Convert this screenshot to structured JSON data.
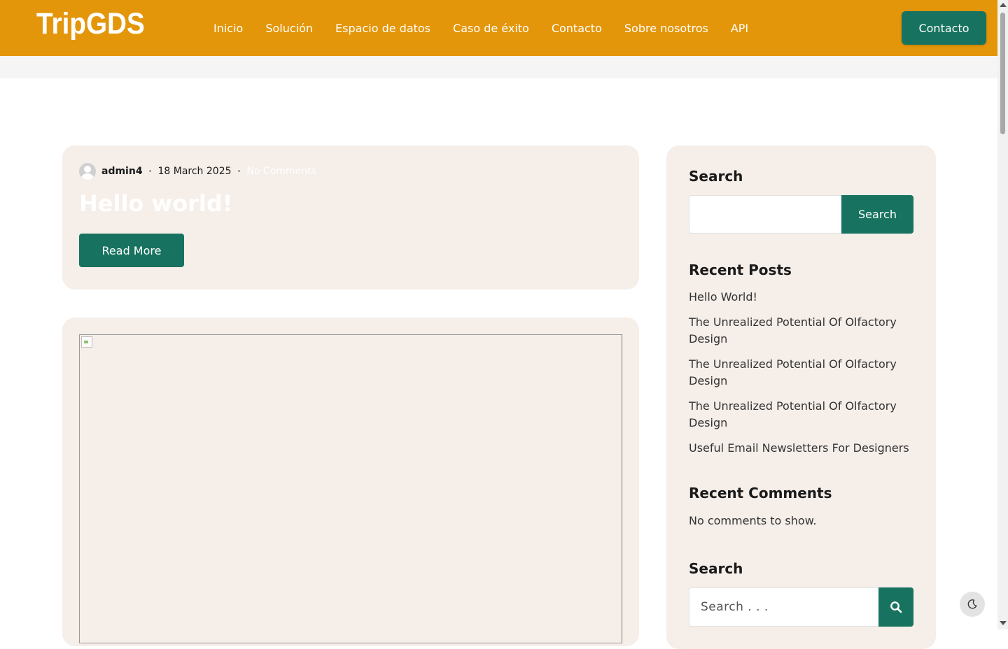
{
  "brand": {
    "logo": "TripGDS"
  },
  "nav": {
    "items": [
      "Inicio",
      "Solución",
      "Espacio de datos",
      "Caso de éxito",
      "Contacto",
      "Sobre nosotros",
      "API"
    ],
    "cta": "Contacto"
  },
  "post": {
    "author": "admin4",
    "date": "18 March 2025",
    "comments": "No Comments",
    "title": "Hello world!",
    "read_more": "Read More"
  },
  "sidebar": {
    "search_title": "Search",
    "search_button": "Search",
    "recent_posts_title": "Recent Posts",
    "recent_posts": [
      "Hello World!",
      "The Unrealized Potential Of Olfactory Design",
      "The Unrealized Potential Of Olfactory Design",
      "The Unrealized Potential Of Olfactory Design",
      "Useful Email Newsletters For Designers"
    ],
    "recent_comments_title": "Recent Comments",
    "no_comments": "No comments to show.",
    "search2_title": "Search",
    "search2_placeholder": "Search . . ."
  },
  "colors": {
    "header": "#e4960a",
    "accent": "#17735f",
    "card": "#f5eee9"
  },
  "icons": {
    "search_button_icon": "magnifier-icon",
    "dark_toggle_icon": "moon-icon"
  }
}
